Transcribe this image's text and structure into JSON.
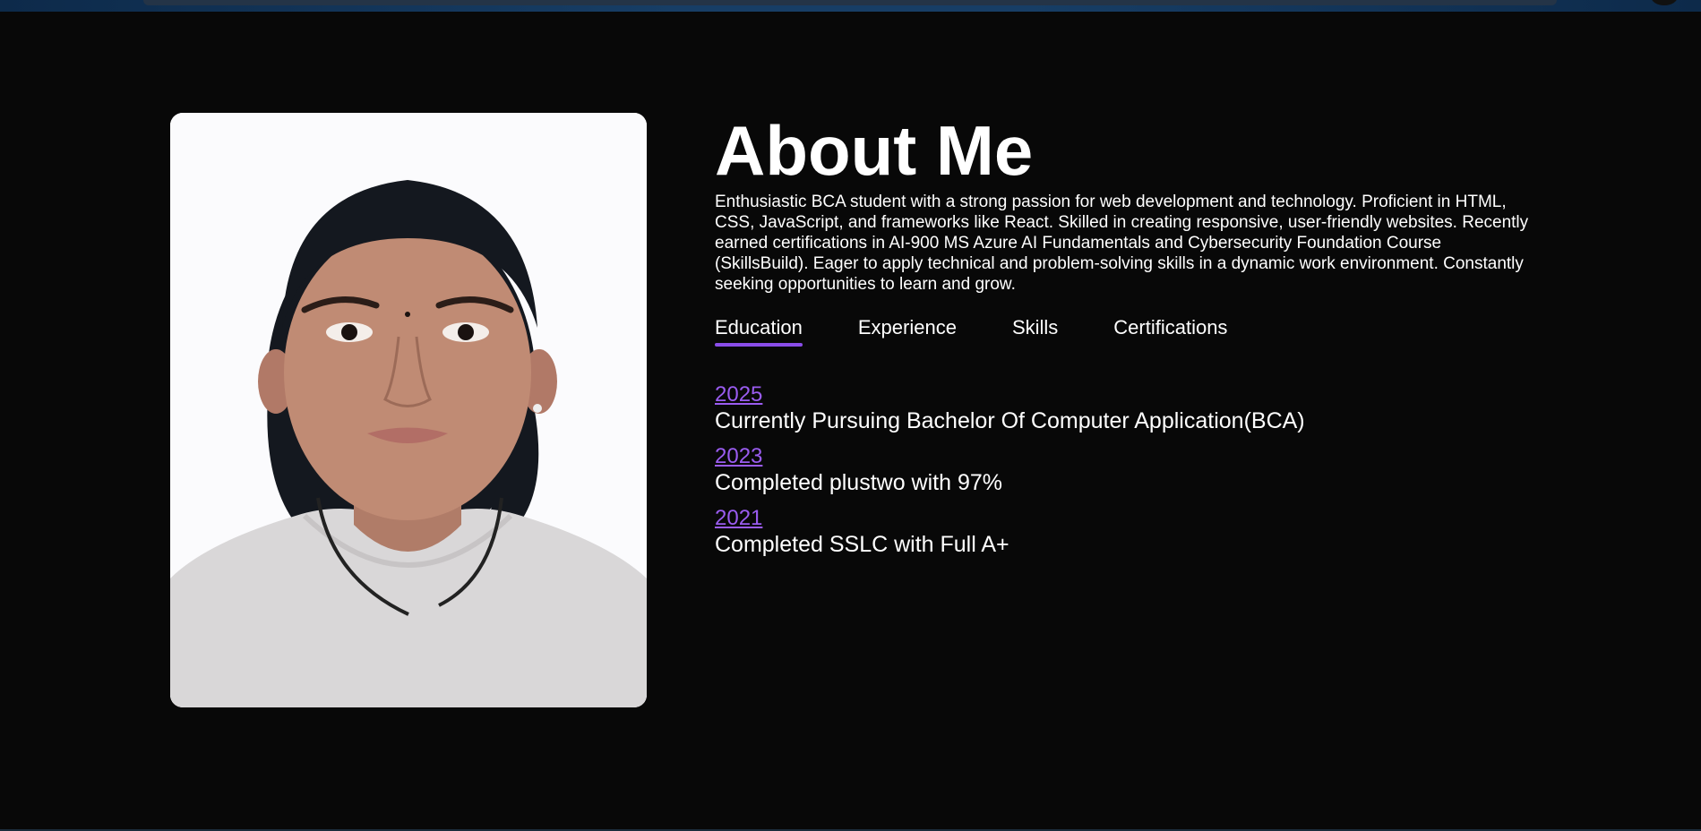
{
  "about": {
    "title": "About Me",
    "description": "Enthusiastic BCA student with a strong passion for web development and technology. Proficient in HTML, CSS, JavaScript, and frameworks like React. Skilled in creating responsive, user-friendly websites. Recently earned certifications in AI-900 MS Azure AI Fundamentals and Cybersecurity Foundation Course (SkillsBuild). Eager to apply technical and problem-solving skills in a dynamic work environment. Constantly seeking opportunities to learn and grow.",
    "tabs": [
      {
        "label": "Education",
        "active": true
      },
      {
        "label": "Experience",
        "active": false
      },
      {
        "label": "Skills",
        "active": false
      },
      {
        "label": "Certifications",
        "active": false
      }
    ],
    "education": [
      {
        "year": "2025",
        "text": "Currently Pursuing Bachelor Of Computer Application(BCA)"
      },
      {
        "year": "2023",
        "text": "Completed plustwo with 97%"
      },
      {
        "year": "2021",
        "text": "Completed SSLC with Full A+"
      }
    ]
  },
  "colors": {
    "background": "#080808",
    "accent": "#8a4dea",
    "link": "#9a5cf0",
    "text": "#ffffff"
  },
  "icons": {
    "profile_photo": "portrait-photo"
  }
}
